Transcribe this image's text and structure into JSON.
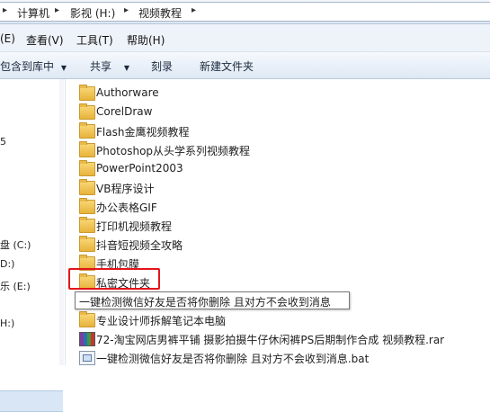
{
  "address": {
    "crumbs": [
      "计算机",
      "影视 (H:)",
      "视频教程"
    ],
    "separator": "▸"
  },
  "menubar": {
    "items": [
      "(E)",
      "查看(V)",
      "工具(T)",
      "帮助(H)"
    ]
  },
  "commandbar": {
    "library": "包含到库中",
    "library_arrow": "▼",
    "share": "共享",
    "share_arrow": "▼",
    "burn": "刻录",
    "new_folder": "新建文件夹"
  },
  "nav": {
    "items": [
      "盘 (C:)",
      "D:)",
      "乐 (E:)",
      "H:)"
    ],
    "marker": "5"
  },
  "files": [
    {
      "name": "Authorware",
      "type": "folder"
    },
    {
      "name": "CorelDraw",
      "type": "folder"
    },
    {
      "name": "Flash金鹰视频教程",
      "type": "folder"
    },
    {
      "name": "Photoshop从头学系列视频教程",
      "type": "folder"
    },
    {
      "name": "PowerPoint2003",
      "type": "folder"
    },
    {
      "name": "VB程序设计",
      "type": "folder"
    },
    {
      "name": "办公表格GIF",
      "type": "folder"
    },
    {
      "name": "打印机视频教程",
      "type": "folder"
    },
    {
      "name": "抖音短视频全攻略",
      "type": "folder"
    },
    {
      "name": "手机包膜",
      "type": "folder"
    },
    {
      "name": "私密文件夹",
      "type": "folder"
    },
    {
      "name": "",
      "type": "folder"
    },
    {
      "name": "专业设计师拆解笔记本电脑",
      "type": "folder"
    },
    {
      "name": "72-淘宝网店男裤平铺 摄影拍摄牛仔休闲裤PS后期制作合成 视频教程.rar",
      "type": "rar"
    },
    {
      "name": "一键检测微信好友是否将你删除 且对方不会收到消息.bat",
      "type": "bat"
    }
  ],
  "tooltip": "一键检测微信好友是否将你删除 且对方不会收到消息",
  "colors": {
    "highlight": "#e3151a"
  }
}
